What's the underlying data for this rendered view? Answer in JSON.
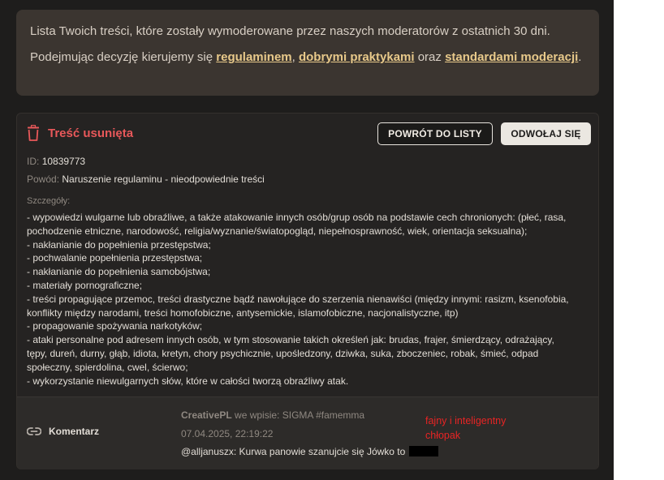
{
  "info": {
    "line1": "Lista Twoich treści, które zostały wymoderowane przez naszych moderatorów z ostatnich 30 dni.",
    "line2_prefix": "Podejmując decyzję kierujemy się ",
    "link_rules": "regulaminem",
    "sep1": ", ",
    "link_practices": "dobrymi praktykami",
    "sep2": " oraz ",
    "link_standards": "standardami moderacji",
    "suffix": "."
  },
  "card": {
    "status_title": "Treść usunięta",
    "back_button": "POWRÓT DO LISTY",
    "appeal_button": "ODWOŁAJ SIĘ",
    "id_label": "ID:",
    "id_value": "10839773",
    "reason_label": "Powód:",
    "reason_value": "Naruszenie regulaminu - nieodpowiednie treści",
    "details_label": "Szczegóły:",
    "details_lines": [
      "- wypowiedzi wulgarne lub obraźliwe, a także atakowanie innych osób/grup osób na podstawie cech chronionych: (płeć, rasa,",
      "pochodzenie etniczne, narodowość, religia/wyznanie/światopogląd, niepełnosprawność, wiek, orientacja seksualna);",
      "- nakłanianie do popełnienia przestępstwa;",
      "- pochwalanie popełnienia przestępstwa;",
      "- nakłanianie do popełnienia samobójstwa;",
      "- materiały pornograficzne;",
      "- treści propagujące przemoc, treści drastyczne bądź nawołujące do szerzenia nienawiści (między innymi: rasizm, ksenofobia,",
      "konflikty między narodami, treści homofobiczne, antysemickie, islamofobiczne, nacjonalistyczne, itp)",
      "- propagowanie spożywania narkotyków;",
      "- ataki personalne pod adresem innych osób, w tym stosowanie takich określeń jak: brudas, frajer, śmierdzący, odrażający,",
      "tępy, dureń, durny, głąb, idiota, kretyn, chory psychicznie, upośledzony, dziwka, suka, zboczeniec, robak, śmieć, odpad",
      "społeczny, spierdolina, cwel, ścierwo;",
      "- wykorzystanie niewulgarnych słów, które w całości tworzą obraźliwy atak."
    ]
  },
  "comment": {
    "type_label": "Komentarz",
    "author": "CreativePL",
    "context": " we wpisie: SIGMA #famemma",
    "date": "07.04.2025, 22:19:22",
    "text": "@alljanuszx: Kurwa panowie szanujcie się Jówko to "
  },
  "annotation": {
    "line1": "fajny  i inteligentny",
    "line2": "chłopak"
  },
  "colors": {
    "panel_bg": "#1e1d1c",
    "info_bg": "#3b3530",
    "link": "#e8c98a",
    "danger": "#e8585a",
    "annotation": "#e82424"
  },
  "icons": {
    "status": "trash-icon",
    "comment_type": "link-icon"
  }
}
